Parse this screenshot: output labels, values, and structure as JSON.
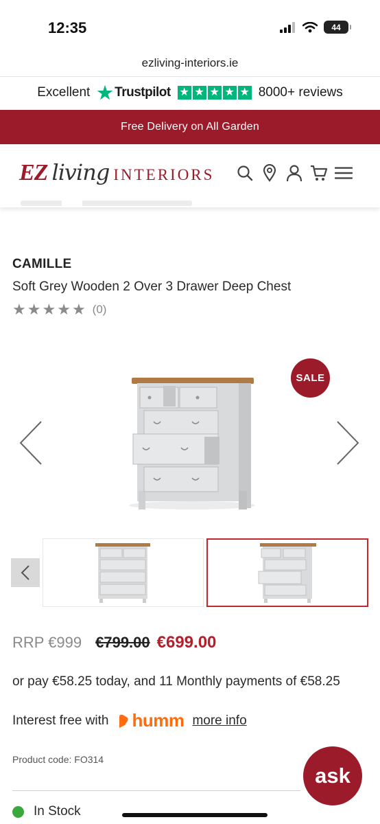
{
  "status_bar": {
    "time": "12:35",
    "battery": "44"
  },
  "browser": {
    "url": "ezliving-interiors.ie"
  },
  "trustpilot": {
    "rating_word": "Excellent",
    "brand": "Trustpilot",
    "reviews": "8000+ reviews",
    "color": "#00b67a"
  },
  "promo": {
    "text": "Free Delivery on All Garden",
    "color": "#9b1b2a"
  },
  "logo": {
    "ez": "EZ",
    "living": "living",
    "interiors": "INTERIORS"
  },
  "header_icons": [
    "search-icon",
    "location-pin-icon",
    "account-icon",
    "cart-icon",
    "menu-icon"
  ],
  "product": {
    "brand": "CAMILLE",
    "title": "Soft Grey Wooden 2 Over 3 Drawer Deep Chest",
    "rating_stars": 0,
    "rating_count": "(0)",
    "sale_badge": "SALE",
    "rrp": "RRP €999",
    "was_price": "€799.00",
    "now_price": "€699.00",
    "finance_text": "or pay €58.25 today, and 11 Monthly payments of €58.25",
    "interest_text": "Interest free with",
    "humm": "humm",
    "more_info": "more info",
    "code": "Product code: FO314",
    "stock": "In Stock",
    "accent_color": "#b3202c"
  },
  "chat": {
    "label": "ask"
  }
}
